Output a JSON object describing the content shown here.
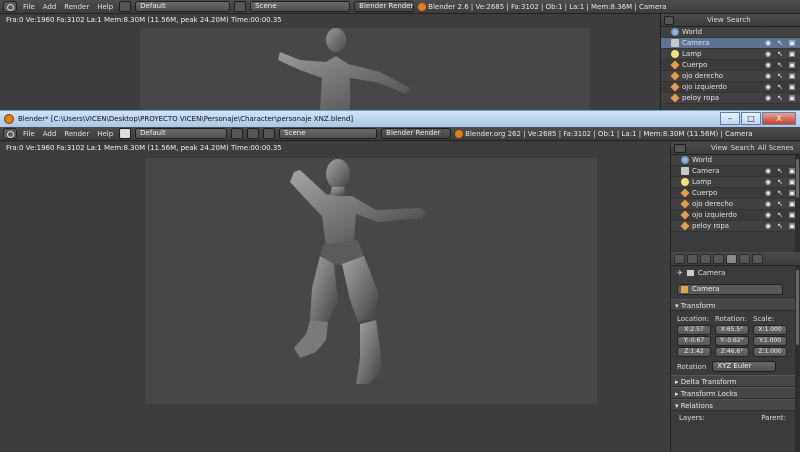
{
  "background_window": {
    "menu": [
      "File",
      "Add",
      "Render",
      "Help"
    ],
    "layout_dropdown": "Default",
    "scene_dropdown": "Scene",
    "engine_dropdown": "Blender Render",
    "stats": "Blender 2.6 | Ve:2685 | Fa:3102 | Ob:1 | La:1 | Mem:8.36M | Camera",
    "viewport_info": "Fra:0  Ve:1960 Fa:3102 La:1 Mem:8.30M (11.56M, peak 24.20M) Time:00:00.35",
    "outliner_header": [
      "View",
      "Search"
    ],
    "outliner_rows": [
      {
        "name": "World",
        "icon": "world-icon"
      },
      {
        "name": "Camera",
        "icon": "camera-icon"
      },
      {
        "name": "Lamp",
        "icon": "lamp-icon"
      },
      {
        "name": "Cuerpo",
        "icon": "mesh-icon"
      },
      {
        "name": "ojo derecho",
        "icon": "mesh-icon"
      },
      {
        "name": "ojo izquierdo",
        "icon": "mesh-icon"
      },
      {
        "name": "peloy ropa",
        "icon": "mesh-icon"
      }
    ]
  },
  "foreground_window": {
    "title": "Blender* [C:\\Users\\VICEN\\Desktop\\PROYECTO VICEN\\Personaje\\Character\\personaje XNZ.blend]",
    "window_buttons": {
      "minimize": "–",
      "maximize": "□",
      "close": "X"
    },
    "menu": [
      "File",
      "Add",
      "Render",
      "Help"
    ],
    "layout_dropdown": "Default",
    "scene_dropdown": "Scene",
    "engine_dropdown": "Blender Render",
    "stats": "Blender.org 262 | Ve:2685 | Fa:3102 | Ob:1 | La:1 | Mem:8.30M (11.56M) | Camera",
    "viewport_info": "Fra:0  Ve:1960 Fa:3102 La:1 Mem:8.30M (11.56M, peak 24.20M) Time:00:00.35",
    "outliner_header": [
      "View",
      "Search",
      "All Scenes"
    ],
    "outliner_rows": [
      {
        "name": "World",
        "icon": "world-icon"
      },
      {
        "name": "Camera",
        "icon": "camera-icon"
      },
      {
        "name": "Lamp",
        "icon": "lamp-icon"
      },
      {
        "name": "Cuerpo",
        "icon": "mesh-icon"
      },
      {
        "name": "ojo derecho",
        "icon": "mesh-icon"
      },
      {
        "name": "ojo izquierdo",
        "icon": "mesh-icon"
      },
      {
        "name": "peloy ropa",
        "icon": "mesh-icon"
      }
    ],
    "properties": {
      "breadcrumb": "Camera",
      "object_name": "Camera",
      "transform_header": "Transform",
      "columns": [
        "Location:",
        "Rotation:",
        "Scale:"
      ],
      "location": [
        "X:2.57",
        "Y:-0.67",
        "Z:1.42"
      ],
      "rotation": [
        "X:65.5°",
        "Y:-0.62°",
        "Z:46.6°"
      ],
      "scale": [
        "X:1.000",
        "Y:1.000",
        "Z:1.000"
      ],
      "rotation_mode_label": "Rotation",
      "rotation_mode": "XYZ Euler",
      "delta_transform": "Delta Transform",
      "transform_locks": "Transform Locks",
      "relations": "Relations",
      "layers_label": "Layers:",
      "parent_label": "Parent:"
    }
  },
  "colors": {
    "accent_orange": "#e87d0d",
    "selection": "#5b7493",
    "titlebar": "#a9c8ea"
  }
}
